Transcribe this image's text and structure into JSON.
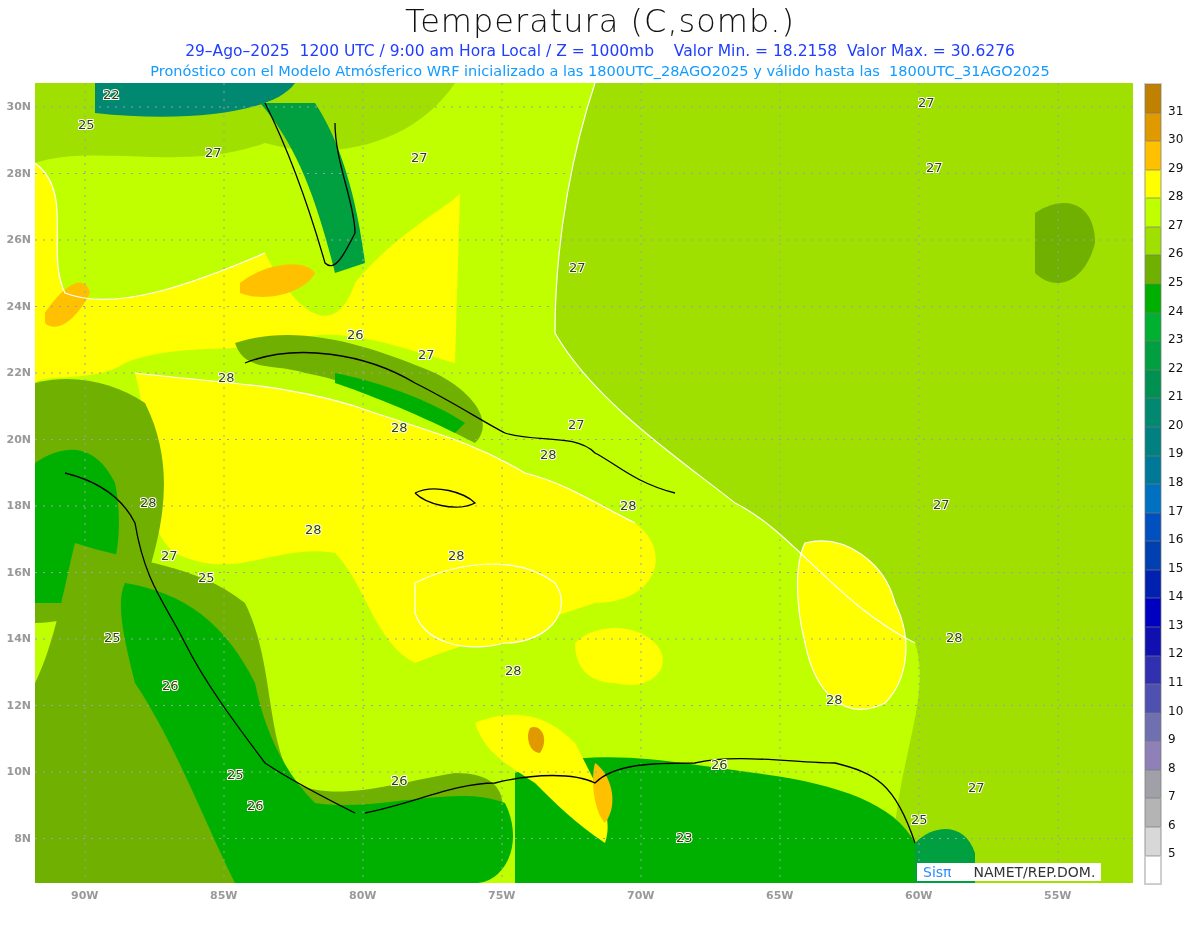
{
  "title": "Temperatura (C,somb.)",
  "subtitle": "29–Ago–2025  1200 UTC / 9:00 am Hora Local / Z = 1000mb    Valor Min. = 18.2158  Valor Max. = 30.6276",
  "description": "Pronóstico con el Modelo Atmósferico WRF inicializado a las 1800UTC_28AGO2025 y válido hasta las  1800UTC_31AGO2025",
  "map": {
    "latitude_labels": [
      "30N",
      "28N",
      "26N",
      "24N",
      "22N",
      "20N",
      "18N",
      "16N",
      "14N",
      "12N",
      "10N",
      "8N"
    ],
    "longitude_labels": [
      "90W",
      "85W",
      "80W",
      "75W",
      "70W",
      "65W",
      "60W",
      "55W"
    ],
    "contour_labels": [
      "22",
      "25",
      "27",
      "27",
      "27",
      "27",
      "27",
      "26",
      "27",
      "28",
      "28",
      "27",
      "28",
      "28",
      "28",
      "27",
      "28",
      "28",
      "27",
      "25",
      "25",
      "28",
      "28",
      "26",
      "28",
      "26",
      "25",
      "26",
      "27",
      "26",
      "25",
      "23"
    ],
    "credit_logo": "Sisπ",
    "credit_text": "NAMET/REP.DOM."
  },
  "colorbar": {
    "swatches": [
      {
        "color": "#c08000"
      },
      {
        "color": "#e09a00"
      },
      {
        "color": "#ffc000"
      },
      {
        "color": "#ffff00"
      },
      {
        "color": "#c0ff00"
      },
      {
        "color": "#a0e000"
      },
      {
        "color": "#70b000"
      },
      {
        "color": "#00b000"
      },
      {
        "color": "#00b030"
      },
      {
        "color": "#00a040"
      },
      {
        "color": "#009050"
      },
      {
        "color": "#008870"
      },
      {
        "color": "#008080"
      },
      {
        "color": "#007898"
      },
      {
        "color": "#0070c0"
      },
      {
        "color": "#0050c0"
      },
      {
        "color": "#0040b0"
      },
      {
        "color": "#0020b0"
      },
      {
        "color": "#0000c0"
      },
      {
        "color": "#1010b0"
      },
      {
        "color": "#3030b0"
      },
      {
        "color": "#5050b0"
      },
      {
        "color": "#7070b0"
      },
      {
        "color": "#9080b8"
      },
      {
        "color": "#a0a0a8"
      },
      {
        "color": "#b4b4b4"
      },
      {
        "color": "#d8d8d8"
      },
      {
        "color": "#ffffff"
      }
    ],
    "labels": [
      "31",
      "30",
      "29",
      "28",
      "27",
      "26",
      "25",
      "24",
      "23",
      "22",
      "21",
      "20",
      "19",
      "18",
      "17",
      "16",
      "15",
      "14",
      "13",
      "12",
      "11",
      "10",
      "9",
      "8",
      "7",
      "6",
      "5"
    ]
  }
}
